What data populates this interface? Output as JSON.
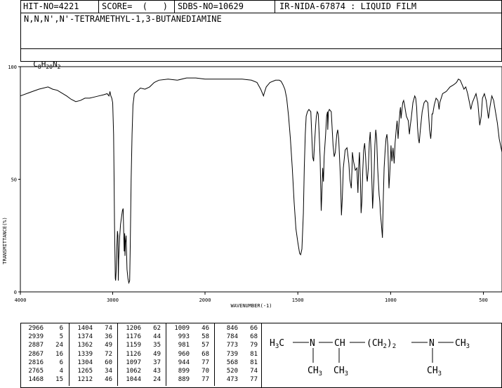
{
  "header": {
    "hit_no": "HIT-NO=4221",
    "score": "SCORE=  (   )",
    "sdbs_no": "SDBS-NO=10629",
    "ir_info": "IR-NIDA-67874 : LIQUID FILM"
  },
  "compound": {
    "name": "N,N,N',N'-TETRAMETHYL-1,3-BUTANEDIAMINE",
    "formula_parts": [
      "C",
      "8",
      "H",
      "20",
      "N",
      "2"
    ]
  },
  "chart_data": {
    "type": "line",
    "title": "",
    "xlabel": "WAVENUMBER(-1)",
    "ylabel": "TRANSMITTANCE(%)",
    "xlim": [
      4000,
      400
    ],
    "ylim": [
      0,
      100
    ],
    "x_axis_reversed": true,
    "x_ticks": [
      "4000",
      "3000",
      "2000",
      "1500",
      "1000",
      "500"
    ],
    "y_ticks": [
      "100",
      "50",
      "0"
    ],
    "grid": false,
    "series": [
      {
        "points": [
          [
            4000,
            87
          ],
          [
            3900,
            88.5
          ],
          [
            3800,
            90
          ],
          [
            3700,
            91
          ],
          [
            3650,
            90
          ],
          [
            3600,
            89.5
          ],
          [
            3500,
            87
          ],
          [
            3450,
            85.5
          ],
          [
            3400,
            84.5
          ],
          [
            3350,
            85
          ],
          [
            3300,
            86
          ],
          [
            3250,
            86
          ],
          [
            3200,
            86.5
          ],
          [
            3150,
            87
          ],
          [
            3100,
            87.5
          ],
          [
            3060,
            88
          ],
          [
            3040,
            87
          ],
          [
            3030,
            89
          ],
          [
            3020,
            87
          ],
          [
            3010,
            86
          ],
          [
            3000,
            84
          ],
          [
            2990,
            70
          ],
          [
            2985,
            50
          ],
          [
            2980,
            30
          ],
          [
            2975,
            15
          ],
          [
            2972,
            6
          ],
          [
            2968,
            5
          ],
          [
            2963,
            9
          ],
          [
            2955,
            20
          ],
          [
            2948,
            27
          ],
          [
            2943,
            25
          ],
          [
            2939,
            5
          ],
          [
            2935,
            14
          ],
          [
            2925,
            24
          ],
          [
            2915,
            30
          ],
          [
            2905,
            33
          ],
          [
            2895,
            36
          ],
          [
            2887,
            37
          ],
          [
            2880,
            25
          ],
          [
            2875,
            18
          ],
          [
            2870,
            26
          ],
          [
            2867,
            16
          ],
          [
            2862,
            22
          ],
          [
            2855,
            25
          ],
          [
            2845,
            10
          ],
          [
            2835,
            6
          ],
          [
            2825,
            4
          ],
          [
            2816,
            5
          ],
          [
            2810,
            20
          ],
          [
            2800,
            50
          ],
          [
            2790,
            70
          ],
          [
            2780,
            83
          ],
          [
            2765,
            88
          ],
          [
            2700,
            90.5
          ],
          [
            2650,
            90
          ],
          [
            2600,
            91
          ],
          [
            2550,
            93
          ],
          [
            2500,
            94
          ],
          [
            2400,
            94.5
          ],
          [
            2300,
            94
          ],
          [
            2200,
            95
          ],
          [
            2100,
            95
          ],
          [
            2000,
            94.5
          ],
          [
            1900,
            94.5
          ],
          [
            1800,
            94.5
          ],
          [
            1750,
            94
          ],
          [
            1720,
            93
          ],
          [
            1700,
            90
          ],
          [
            1690,
            88
          ],
          [
            1685,
            87
          ],
          [
            1680,
            88.5
          ],
          [
            1670,
            91
          ],
          [
            1650,
            93
          ],
          [
            1620,
            94
          ],
          [
            1600,
            94
          ],
          [
            1590,
            93.5
          ],
          [
            1580,
            92
          ],
          [
            1570,
            90
          ],
          [
            1560,
            86
          ],
          [
            1550,
            78
          ],
          [
            1540,
            68
          ],
          [
            1530,
            55
          ],
          [
            1520,
            40
          ],
          [
            1510,
            28
          ],
          [
            1500,
            22
          ],
          [
            1490,
            17
          ],
          [
            1485,
            16.5
          ],
          [
            1478,
            19
          ],
          [
            1470,
            35
          ],
          [
            1465,
            55
          ],
          [
            1460,
            70
          ],
          [
            1455,
            78
          ],
          [
            1448,
            80
          ],
          [
            1440,
            81
          ],
          [
            1430,
            80
          ],
          [
            1425,
            70
          ],
          [
            1420,
            60
          ],
          [
            1415,
            58
          ],
          [
            1410,
            66
          ],
          [
            1404,
            74
          ],
          [
            1400,
            78
          ],
          [
            1395,
            80
          ],
          [
            1390,
            79
          ],
          [
            1385,
            70
          ],
          [
            1380,
            60
          ],
          [
            1374,
            36
          ],
          [
            1370,
            45
          ],
          [
            1366,
            55
          ],
          [
            1362,
            49
          ],
          [
            1358,
            60
          ],
          [
            1350,
            70
          ],
          [
            1345,
            78
          ],
          [
            1340,
            80
          ],
          [
            1339,
            72
          ],
          [
            1335,
            80
          ],
          [
            1330,
            81
          ],
          [
            1320,
            80
          ],
          [
            1310,
            65
          ],
          [
            1304,
            60
          ],
          [
            1298,
            62
          ],
          [
            1290,
            70
          ],
          [
            1285,
            72
          ],
          [
            1280,
            68
          ],
          [
            1270,
            50
          ],
          [
            1265,
            34
          ],
          [
            1260,
            42
          ],
          [
            1255,
            55
          ],
          [
            1245,
            63
          ],
          [
            1235,
            64
          ],
          [
            1225,
            57
          ],
          [
            1220,
            50
          ],
          [
            1212,
            46
          ],
          [
            1208,
            55
          ],
          [
            1206,
            62
          ],
          [
            1200,
            58
          ],
          [
            1190,
            54
          ],
          [
            1182,
            55
          ],
          [
            1176,
            44
          ],
          [
            1172,
            56
          ],
          [
            1168,
            62
          ],
          [
            1163,
            50
          ],
          [
            1159,
            35
          ],
          [
            1155,
            40
          ],
          [
            1150,
            54
          ],
          [
            1145,
            63
          ],
          [
            1140,
            66
          ],
          [
            1135,
            60
          ],
          [
            1130,
            52
          ],
          [
            1126,
            49
          ],
          [
            1120,
            55
          ],
          [
            1115,
            66
          ],
          [
            1110,
            71
          ],
          [
            1105,
            62
          ],
          [
            1097,
            37
          ],
          [
            1090,
            50
          ],
          [
            1085,
            65
          ],
          [
            1080,
            72
          ],
          [
            1075,
            68
          ],
          [
            1070,
            55
          ],
          [
            1062,
            43
          ],
          [
            1058,
            40
          ],
          [
            1055,
            35
          ],
          [
            1050,
            30
          ],
          [
            1046,
            26
          ],
          [
            1044,
            24
          ],
          [
            1040,
            40
          ],
          [
            1035,
            55
          ],
          [
            1030,
            62
          ],
          [
            1025,
            68
          ],
          [
            1020,
            70
          ],
          [
            1015,
            65
          ],
          [
            1009,
            46
          ],
          [
            1005,
            52
          ],
          [
            998,
            65
          ],
          [
            993,
            58
          ],
          [
            987,
            64
          ],
          [
            981,
            57
          ],
          [
            976,
            66
          ],
          [
            970,
            72
          ],
          [
            965,
            76
          ],
          [
            960,
            68
          ],
          [
            955,
            75
          ],
          [
            950,
            80
          ],
          [
            947,
            82
          ],
          [
            944,
            77
          ],
          [
            940,
            80
          ],
          [
            935,
            84
          ],
          [
            930,
            85
          ],
          [
            925,
            83
          ],
          [
            915,
            78
          ],
          [
            905,
            76
          ],
          [
            899,
            70
          ],
          [
            894,
            74
          ],
          [
            889,
            77
          ],
          [
            880,
            84
          ],
          [
            870,
            87
          ],
          [
            865,
            86
          ],
          [
            860,
            82
          ],
          [
            855,
            73
          ],
          [
            850,
            68
          ],
          [
            846,
            66
          ],
          [
            840,
            72
          ],
          [
            830,
            80
          ],
          [
            820,
            84
          ],
          [
            810,
            85
          ],
          [
            800,
            84
          ],
          [
            795,
            78
          ],
          [
            790,
            72
          ],
          [
            784,
            68
          ],
          [
            780,
            72
          ],
          [
            777,
            79
          ],
          [
            773,
            79
          ],
          [
            765,
            83
          ],
          [
            755,
            86
          ],
          [
            745,
            85
          ],
          [
            739,
            81
          ],
          [
            735,
            84
          ],
          [
            720,
            88
          ],
          [
            700,
            89
          ],
          [
            680,
            91
          ],
          [
            660,
            92
          ],
          [
            645,
            93
          ],
          [
            635,
            94.5
          ],
          [
            625,
            94
          ],
          [
            615,
            92
          ],
          [
            605,
            90
          ],
          [
            595,
            91
          ],
          [
            585,
            88
          ],
          [
            575,
            84
          ],
          [
            568,
            81
          ],
          [
            560,
            84
          ],
          [
            550,
            86
          ],
          [
            540,
            88
          ],
          [
            530,
            84
          ],
          [
            520,
            74
          ],
          [
            512,
            78
          ],
          [
            505,
            86
          ],
          [
            495,
            88
          ],
          [
            485,
            85
          ],
          [
            473,
            77
          ],
          [
            465,
            82
          ],
          [
            455,
            87
          ],
          [
            445,
            85
          ],
          [
            435,
            80
          ],
          [
            425,
            75
          ],
          [
            415,
            68
          ],
          [
            400,
            62
          ]
        ]
      }
    ]
  },
  "peaks": [
    [
      [
        "2966",
        "6"
      ],
      [
        "2939",
        "5"
      ],
      [
        "2887",
        "24"
      ],
      [
        "2867",
        "16"
      ],
      [
        "2816",
        "6"
      ],
      [
        "2765",
        "4"
      ],
      [
        "1468",
        "15"
      ]
    ],
    [
      [
        "1404",
        "74"
      ],
      [
        "1374",
        "36"
      ],
      [
        "1362",
        "49"
      ],
      [
        "1339",
        "72"
      ],
      [
        "1304",
        "60"
      ],
      [
        "1265",
        "34"
      ],
      [
        "1212",
        "46"
      ]
    ],
    [
      [
        "1206",
        "62"
      ],
      [
        "1176",
        "44"
      ],
      [
        "1159",
        "35"
      ],
      [
        "1126",
        "49"
      ],
      [
        "1097",
        "37"
      ],
      [
        "1062",
        "43"
      ],
      [
        "1044",
        "24"
      ]
    ],
    [
      [
        "1009",
        "46"
      ],
      [
        "993",
        "58"
      ],
      [
        "981",
        "57"
      ],
      [
        "960",
        "68"
      ],
      [
        "944",
        "77"
      ],
      [
        "899",
        "70"
      ],
      [
        "889",
        "77"
      ]
    ],
    [
      [
        "846",
        "66"
      ],
      [
        "784",
        "68"
      ],
      [
        "773",
        "79"
      ],
      [
        "739",
        "81"
      ],
      [
        "568",
        "81"
      ],
      [
        "520",
        "74"
      ],
      [
        "473",
        "77"
      ]
    ]
  ],
  "structure": {
    "h3c_left": "H",
    "h3c_left_sub": "3",
    "h3c_left_c": "C",
    "n_left": "N",
    "ch": "CH",
    "ch2_group": "(CH",
    "ch2_sub": "2",
    "ch2_close": ")",
    "ch2_count": "2",
    "n_right": "N",
    "ch3_right": "CH",
    "ch3_right_sub": "3",
    "ch3_below_n": "CH",
    "ch3_below_n_sub": "3",
    "ch3_below_ch": "CH",
    "ch3_below_ch_sub": "3",
    "ch3_below_nr": "CH",
    "ch3_below_nr_sub": "3"
  }
}
